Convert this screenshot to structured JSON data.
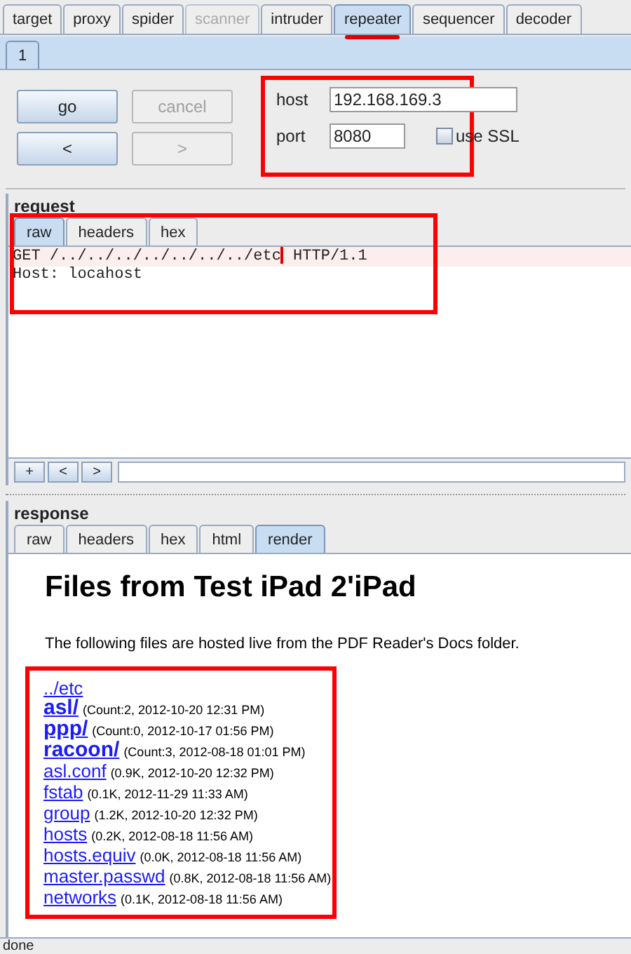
{
  "main_tabs": [
    {
      "label": "target",
      "selected": false,
      "disabled": false
    },
    {
      "label": "proxy",
      "selected": false,
      "disabled": false
    },
    {
      "label": "spider",
      "selected": false,
      "disabled": false
    },
    {
      "label": "scanner",
      "selected": false,
      "disabled": true
    },
    {
      "label": "intruder",
      "selected": false,
      "disabled": false
    },
    {
      "label": "repeater",
      "selected": true,
      "disabled": false
    },
    {
      "label": "sequencer",
      "selected": false,
      "disabled": false
    },
    {
      "label": "decoder",
      "selected": false,
      "disabled": false
    }
  ],
  "sub_tabs": [
    {
      "label": "1",
      "selected": true
    }
  ],
  "buttons": [
    {
      "label": "go",
      "disabled": false
    },
    {
      "label": "cancel",
      "disabled": true
    },
    {
      "label": "<",
      "disabled": false
    },
    {
      "label": ">",
      "disabled": true
    }
  ],
  "host": {
    "label": "host",
    "value": "192.168.169.3"
  },
  "port": {
    "label": "port",
    "value": "8080"
  },
  "ssl": {
    "label": "use SSL",
    "checked": false
  },
  "request": {
    "title": "request",
    "tabs": [
      {
        "label": "raw",
        "selected": true
      },
      {
        "label": "headers",
        "selected": false
      },
      {
        "label": "hex",
        "selected": false
      }
    ],
    "lines": [
      {
        "before": "GET /../../../../../../../etc",
        "after": " HTTP/1.1",
        "highlighted": true
      },
      {
        "before": "Host: locahost",
        "highlighted": false
      }
    ],
    "nav_buttons": [
      "+",
      "<",
      ">"
    ]
  },
  "response": {
    "title": "response",
    "tabs": [
      {
        "label": "raw",
        "selected": false
      },
      {
        "label": "headers",
        "selected": false
      },
      {
        "label": "hex",
        "selected": false
      },
      {
        "label": "html",
        "selected": false
      },
      {
        "label": "render",
        "selected": true
      }
    ],
    "heading": "Files from Test iPad 2'iPad",
    "intro": "The following files are hosted live from the PDF Reader's Docs folder.",
    "entries": [
      {
        "kind": "parent",
        "name": "../etc"
      },
      {
        "kind": "dir",
        "name": "asl/",
        "info": "(Count:2, 2012-10-20 12:31 PM)"
      },
      {
        "kind": "dir",
        "name": "ppp/",
        "info": "(Count:0, 2012-10-17 01:56 PM)"
      },
      {
        "kind": "dir",
        "name": "racoon/",
        "info": "(Count:3, 2012-08-18 01:01 PM)"
      },
      {
        "kind": "file",
        "name": "asl.conf",
        "info": "(0.9K, 2012-10-20 12:32 PM)"
      },
      {
        "kind": "file",
        "name": "fstab",
        "info": "(0.1K, 2012-11-29 11:33 AM)"
      },
      {
        "kind": "file",
        "name": "group",
        "info": "(1.2K, 2012-10-20 12:32 PM)"
      },
      {
        "kind": "file",
        "name": "hosts",
        "info": "(0.2K, 2012-08-18 11:56 AM)"
      },
      {
        "kind": "file",
        "name": "hosts.equiv",
        "info": "(0.0K, 2012-08-18 11:56 AM)"
      },
      {
        "kind": "file",
        "name": "master.passwd",
        "info": "(0.8K, 2012-08-18 11:56 AM)"
      },
      {
        "kind": "file",
        "name": "networks",
        "info": "(0.1K, 2012-08-18 11:56 AM)"
      }
    ]
  },
  "status_bar": "done"
}
